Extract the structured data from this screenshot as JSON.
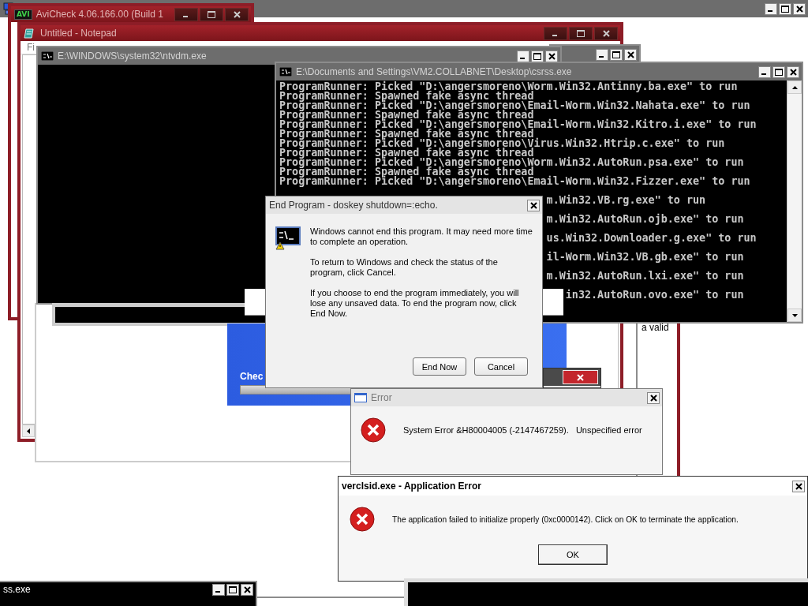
{
  "avicheck_window": {
    "logo_text": "AVI",
    "title": "AviCheck 4.06.166.00 (Build 1"
  },
  "notepad_window": {
    "title": "Untitled - Notepad",
    "menu_item": "Fi"
  },
  "ntvdm_window": {
    "title": "E:\\WINDOWS\\system32\\ntvdm.exe"
  },
  "csrss_window": {
    "title": "E:\\Documents and Settings\\VM2.COLLABNET\\Desktop\\csrss.exe",
    "lines": [
      "ProgramRunner: Picked \"D:\\angersmoreno\\Worm.Win32.Antinny.ba.exe\" to run",
      "ProgramRunner: Spawned fake async thread",
      "ProgramRunner: Picked \"D:\\angersmoreno\\Email-Worm.Win32.Nahata.exe\" to run",
      "ProgramRunner: Spawned fake async thread",
      "ProgramRunner: Picked \"D:\\angersmoreno\\Email-Worm.Win32.Kitro.i.exe\" to run",
      "ProgramRunner: Spawned fake async thread",
      "ProgramRunner: Picked \"D:\\angersmoreno\\Virus.Win32.Htrip.c.exe\" to run",
      "ProgramRunner: Spawned fake async thread",
      "ProgramRunner: Picked \"D:\\angersmoreno\\Worm.Win32.AutoRun.psa.exe\" to run",
      "ProgramRunner: Spawned fake async thread",
      "ProgramRunner: Picked \"D:\\angersmoreno\\Email-Worm.Win32.Fizzer.exe\" to run"
    ],
    "line_fragments": [
      "m.Win32.VB.rg.exe\" to run",
      "m.Win32.AutoRun.ojb.exe\" to run",
      "us.Win32.Downloader.g.exe\" to run",
      "il-Worm.Win32.VB.gb.exe\" to run",
      "m.Win32.AutoRun.lxi.exe\" to run",
      "in32.AutoRun.ovo.exe\" to run"
    ]
  },
  "setup_panel": {
    "text": "Chec",
    "progress": {
      "level": 0
    }
  },
  "side_window": {
    "text": "a valid"
  },
  "end_program_dialog": {
    "title": "End Program - doskey shutdown=:echo.",
    "paragraphs": [
      "Windows cannot end this program. It may need more time to complete an operation.",
      "To return to Windows and check the status of the program, click Cancel.",
      "If you choose to end the program immediately, you will lose any unsaved data. To end the program now, click End Now."
    ],
    "buttons": [
      "End Now",
      "Cancel"
    ]
  },
  "error_dialog": {
    "title": "Error",
    "message": "System Error &H80004005 (-2147467259).   Unspecified error"
  },
  "application_error_dialog": {
    "title": "verclsid.exe - Application Error",
    "message": "The application failed to initialize properly (0xc0000142). Click on OK to terminate the application.",
    "button": "OK"
  },
  "bottom_window": {
    "title": "ss.exe"
  }
}
